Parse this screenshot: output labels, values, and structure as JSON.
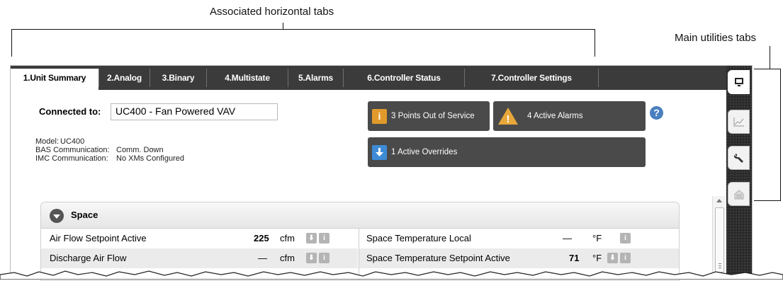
{
  "annotations": {
    "associated_tabs": "Associated horizontal tabs",
    "main_utilities": "Main utilities tabs"
  },
  "tabs": [
    {
      "label": "1.Unit Summary",
      "active": true
    },
    {
      "label": "2.Analog"
    },
    {
      "label": "3.Binary"
    },
    {
      "label": "4.Multistate"
    },
    {
      "label": "5.Alarms"
    },
    {
      "label": "6.Controller Status"
    },
    {
      "label": "7.Controller Settings"
    }
  ],
  "utility_tabs": [
    {
      "icon": "monitor-icon",
      "active": true
    },
    {
      "icon": "trend-chart-icon"
    },
    {
      "icon": "wrench-icon"
    },
    {
      "icon": "document-stack-icon"
    }
  ],
  "summary": {
    "connected_label": "Connected to:",
    "connected_value": "UC400 - Fan Powered VAV",
    "model_label": "Model:",
    "model_value": "UC400",
    "bas_label": "BAS Communication:",
    "bas_value": "Comm. Down",
    "imc_label": "IMC Communication:",
    "imc_value": "No XMs Configured"
  },
  "status": {
    "out_of_service": "3 Points Out of Service",
    "active_alarms": "4 Active Alarms",
    "active_overrides": "1 Active Overrides",
    "info_glyph": "i",
    "alarm_glyph": "!",
    "help_glyph": "?"
  },
  "space": {
    "title": "Space",
    "rows_left": [
      {
        "label": "Air Flow Setpoint Active",
        "value": "225",
        "unit": "cfm"
      },
      {
        "label": "Discharge Air Flow",
        "value": "—",
        "unit": "cfm"
      }
    ],
    "rows_right": [
      {
        "label": "Space Temperature Local",
        "value": "—",
        "unit": "°F"
      },
      {
        "label": "Space Temperature Setpoint Active",
        "value": "71",
        "unit": "°F"
      }
    ],
    "info_glyph": "i",
    "override_glyph": "⬇"
  },
  "colors": {
    "tabbar": "#3b3b3b",
    "status_box": "#4a4a4a",
    "info_orange": "#e09a2b",
    "override_blue": "#3d8bd6",
    "help_blue": "#4a7fbf"
  }
}
